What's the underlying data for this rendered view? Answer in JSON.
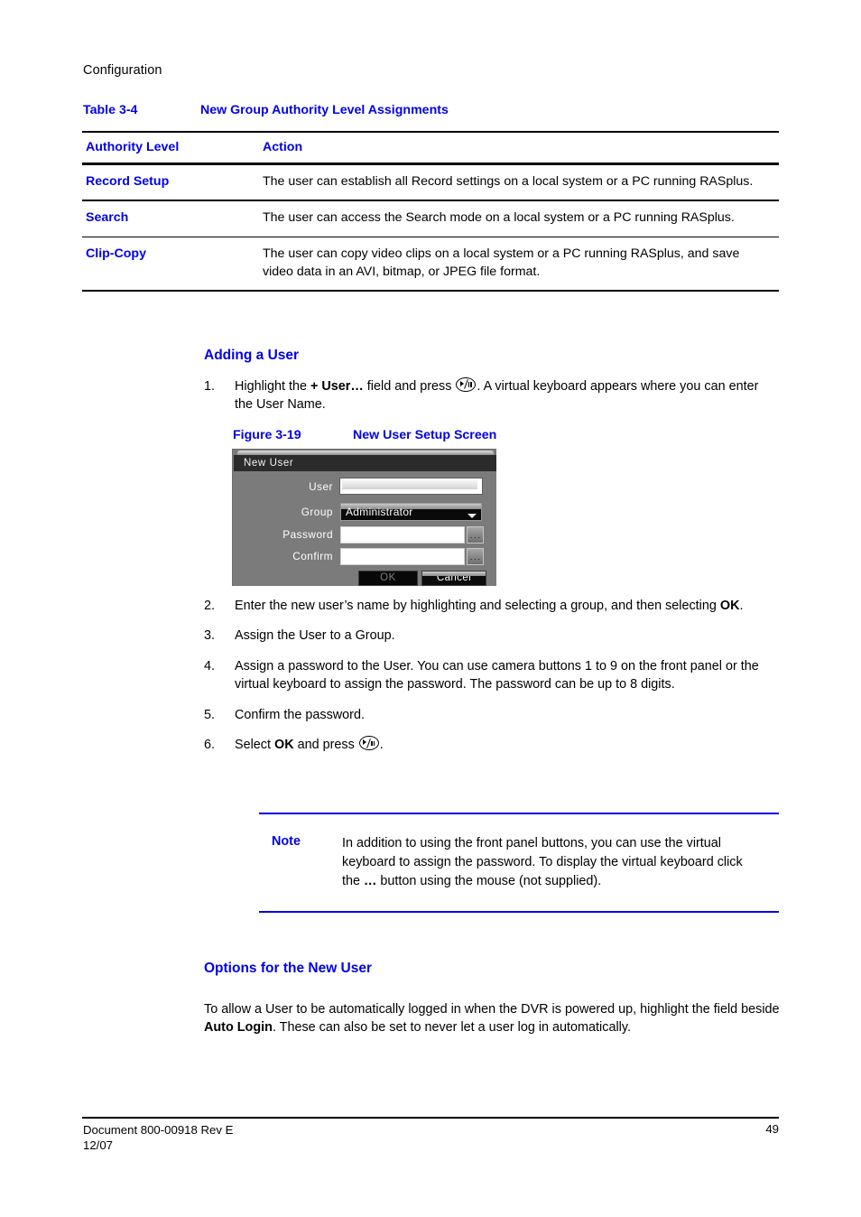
{
  "page": {
    "running_header": "Configuration"
  },
  "table": {
    "caption_number": "Table 3-4",
    "caption_title": "New Group Authority Level Assignments",
    "columns": [
      "Authority Level",
      "Action"
    ],
    "rows": [
      {
        "level": "Record Setup",
        "action": "The user can establish all Record settings on a local system or a PC running RASplus."
      },
      {
        "level": "Search",
        "action": "The user can access the Search mode on a local system or a PC running RASplus."
      },
      {
        "level": "Clip-Copy",
        "action": "The user can copy video clips on a local system or a PC running RASplus, and save video data in an AVI, bitmap, or JPEG file format."
      }
    ]
  },
  "adding_user": {
    "heading": "Adding a User",
    "step1": {
      "number": "1.",
      "part1": "Highlight the ",
      "bold1": "+ User…",
      "part2": " field and press ",
      "icon": "play-pause-icon",
      "part3": ". A virtual keyboard appears where you can enter the User Name."
    }
  },
  "figure": {
    "caption_number": "Figure 3-19",
    "caption_title": "New User Setup Screen"
  },
  "dialog": {
    "title": "New User",
    "fields": {
      "user_label": "User",
      "user_value": "",
      "group_label": "Group",
      "group_value": "Administrator",
      "password_label": "Password",
      "password_value": "",
      "confirm_label": "Confirm",
      "confirm_value": ""
    },
    "ellipsis_button_label": "...",
    "ok_label": "OK",
    "cancel_label": "Cancel"
  },
  "steps": [
    {
      "number": "2.",
      "part1": "Enter the new user’s name by highlighting and selecting a group, and then selecting ",
      "bold": "OK",
      "part2": "."
    },
    {
      "number": "3.",
      "part1": "Assign the User to a Group.",
      "bold": "",
      "part2": ""
    },
    {
      "number": "4.",
      "part1": "Assign a password to the User. You can use camera buttons 1 to 9 on the front panel or the virtual keyboard to assign the password. The password can be up to 8 digits.",
      "bold": "",
      "part2": ""
    },
    {
      "number": "5.",
      "part1": "Confirm the password.",
      "bold": "",
      "part2": ""
    },
    {
      "number": "6.",
      "part1": "Select ",
      "bold": "OK",
      "part2": " and press "
    }
  ],
  "step6_tail": ".",
  "note": {
    "keyword": "Note",
    "part1": "In addition to using the front panel buttons, you can use the virtual keyboard to assign the password. To display the virtual keyboard click the ",
    "bold": "…",
    "part2": " button using the mouse (not supplied)."
  },
  "options_section": {
    "heading": "Options for the New User",
    "part1": "To allow a User to be automatically logged in when the DVR is powered up, highlight the field beside ",
    "bold": "Auto Login",
    "part2": ". These can also be set to never let a user log in automatically."
  },
  "footer": {
    "document": "Document 800-00918 Rev E",
    "date": "12/07",
    "page_number": "49"
  },
  "colors": {
    "heading_blue": "#0000e6",
    "text_black": "#000000",
    "dialog_bg": "#7b7b7b",
    "dialog_titlebar": "#2b2b2b"
  }
}
